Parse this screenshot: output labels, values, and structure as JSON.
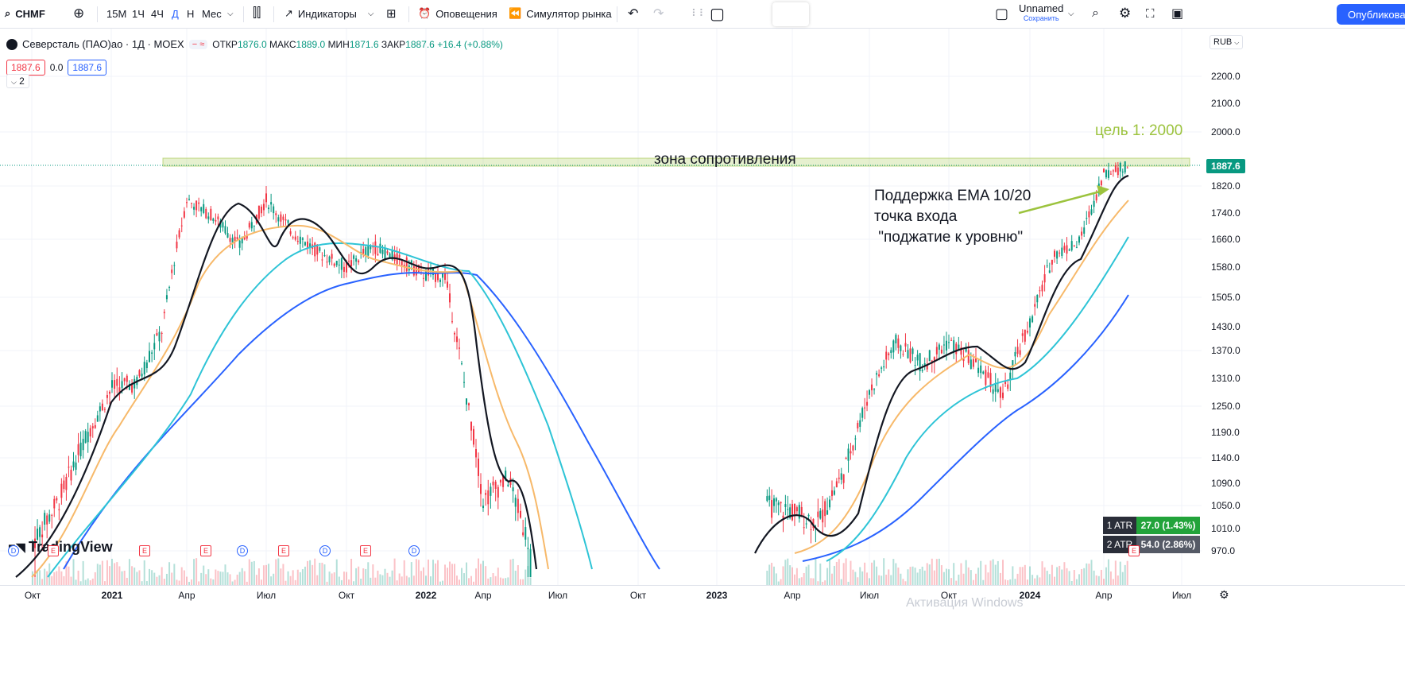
{
  "toolbar": {
    "symbol": "CHMF",
    "intervals": [
      "15М",
      "1Ч",
      "4Ч",
      "Д",
      "Н",
      "Мес"
    ],
    "active_interval": "Д",
    "indicators_label": "Индикаторы",
    "alerts_label": "Оповещения",
    "simulator_label": "Симулятор рынка",
    "layout_name": "Unnamed",
    "layout_status": "Сохранить",
    "publish_label": "Опубликовать"
  },
  "legend": {
    "title": "Северсталь (ПАО)ао · 1Д · MOEX",
    "open_label": "ОТКР",
    "open": "1876.0",
    "high_label": "МАКС",
    "high": "1889.0",
    "low_label": "МИН",
    "low": "1871.6",
    "close_label": "ЗАКР",
    "close": "1887.6",
    "change": "+16.4 (+0.88%)",
    "bid": "1887.6",
    "spread": "0.0",
    "ask": "1887.6",
    "indicator_count": "2"
  },
  "axis": {
    "currency": "RUB",
    "y_ticks": [
      "2200.0",
      "2100.0",
      "2000.0",
      "1820.0",
      "1740.0",
      "1660.0",
      "1580.0",
      "1505.0",
      "1430.0",
      "1370.0",
      "1310.0",
      "1250.0",
      "1190.0",
      "1140.0",
      "1090.0",
      "1050.0",
      "1010.0",
      "970.0"
    ],
    "x_ticks": [
      "Окт",
      "2021",
      "Апр",
      "Июл",
      "Окт",
      "2022",
      "Апр",
      "Июл",
      "Окт",
      "2023",
      "Апр",
      "Июл",
      "Окт",
      "2024",
      "Апр",
      "Июл"
    ],
    "last_price": "1887.6"
  },
  "annotations": {
    "target": "цель 1: 2000",
    "zone": "зона сопротивления",
    "support": "Поддержка EMA 10/20\nточка входа\n \"поджатие к уровню\""
  },
  "atr": [
    {
      "label": "1 ATR",
      "value": "27.0 (1.43%)",
      "color": "#22a33a"
    },
    {
      "label": "2 ATR",
      "value": "54.0 (2.86%)",
      "color": "#555a66"
    }
  ],
  "events": [
    "E",
    "D",
    "E",
    "E",
    "D",
    "E",
    "D",
    "E",
    "D",
    "E",
    "D",
    "E"
  ],
  "branding": "TradingView",
  "watermark": "Активация Windows",
  "colors": {
    "ema10": "#131722",
    "ema20": "#f7b96a",
    "ema50": "#2ec4d6",
    "ema100": "#2962ff",
    "up": "#089981",
    "down": "#f23645",
    "target": "#9cc33e"
  },
  "chart_data": {
    "type": "candlestick",
    "title": "Северсталь (ПАО)ао · 1Д · MOEX",
    "x_range": [
      "2020-10",
      "2024-07"
    ],
    "y_range": [
      970,
      2200
    ],
    "close_path": [
      {
        "x": "2020-10",
        "y": 985
      },
      {
        "x": "2020-11",
        "y": 1060
      },
      {
        "x": "2020-12",
        "y": 1180
      },
      {
        "x": "2021-01",
        "y": 1290
      },
      {
        "x": "2021-02",
        "y": 1300
      },
      {
        "x": "2021-03",
        "y": 1420
      },
      {
        "x": "2021-04",
        "y": 1780
      },
      {
        "x": "2021-05",
        "y": 1730
      },
      {
        "x": "2021-06",
        "y": 1640
      },
      {
        "x": "2021-07",
        "y": 1780
      },
      {
        "x": "2021-08",
        "y": 1680
      },
      {
        "x": "2021-09",
        "y": 1620
      },
      {
        "x": "2021-10",
        "y": 1580
      },
      {
        "x": "2021-11",
        "y": 1640
      },
      {
        "x": "2021-12",
        "y": 1600
      },
      {
        "x": "2022-01",
        "y": 1560
      },
      {
        "x": "2022-02",
        "y": 1560
      },
      {
        "x": "2022-03",
        "y": 1300
      },
      {
        "x": "2022-04",
        "y": 1060
      },
      {
        "x": "2022-05",
        "y": 1100
      },
      {
        "x": "2022-06",
        "y": 960
      },
      {
        "x": "2023-03",
        "y": 1050
      },
      {
        "x": "2023-04",
        "y": 1040
      },
      {
        "x": "2023-05",
        "y": 1020
      },
      {
        "x": "2023-06",
        "y": 1110
      },
      {
        "x": "2023-07",
        "y": 1280
      },
      {
        "x": "2023-08",
        "y": 1390
      },
      {
        "x": "2023-09",
        "y": 1340
      },
      {
        "x": "2023-10",
        "y": 1390
      },
      {
        "x": "2023-11",
        "y": 1340
      },
      {
        "x": "2023-12",
        "y": 1270
      },
      {
        "x": "2024-01",
        "y": 1440
      },
      {
        "x": "2024-02",
        "y": 1620
      },
      {
        "x": "2024-03",
        "y": 1650
      },
      {
        "x": "2024-04",
        "y": 1860
      },
      {
        "x": "2024-05",
        "y": 1887.6
      }
    ],
    "resistance_zone": [
      1875,
      1895
    ],
    "target": 2000
  }
}
